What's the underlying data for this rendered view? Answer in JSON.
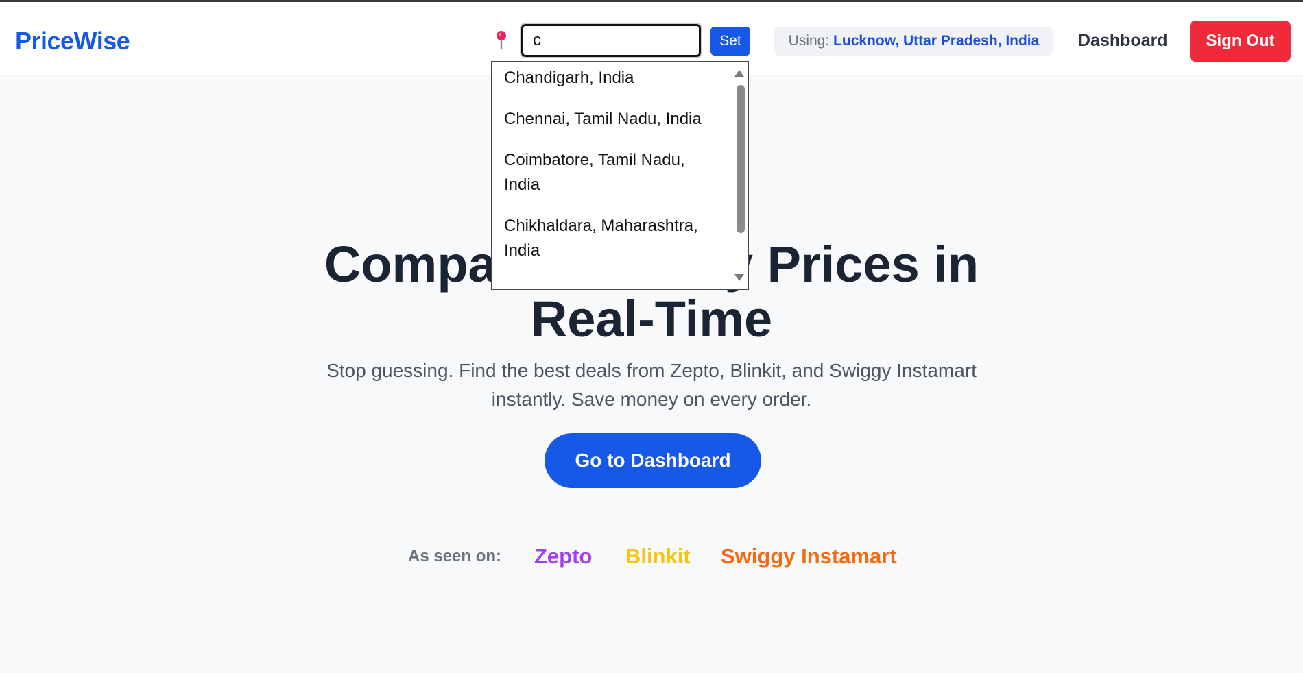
{
  "app": {
    "logo": "PriceWise"
  },
  "location": {
    "pin_icon": "map-pin-icon",
    "input_value": "c",
    "set_label": "Set",
    "using_prefix": "Using:",
    "using_city": "Lucknow, Uttar Pradesh, India",
    "suggestions": [
      {
        "line1": "Chandigarh, India",
        "line2": ""
      },
      {
        "line1": "Chennai, Tamil Nadu, India",
        "line2": ""
      },
      {
        "line1": "Coimbatore, Tamil Nadu,",
        "line2": "India"
      },
      {
        "line1": "Chikhaldara, Maharashtra,",
        "line2": "India"
      }
    ]
  },
  "nav": {
    "dashboard_label": "Dashboard",
    "signout_label": "Sign Out"
  },
  "hero": {
    "title_line1": "Compare Grocery Prices in",
    "title_line2": "Real-Time",
    "subtitle_line1": "Stop guessing. Find the best deals from Zepto, Blinkit, and Swiggy Instamart",
    "subtitle_line2": "instantly. Save money on every order.",
    "cta_label": "Go to Dashboard"
  },
  "seen_on": {
    "label": "As seen on:",
    "brands": [
      {
        "name": "Zepto",
        "color": "#a33ef0"
      },
      {
        "name": "Blinkit",
        "color": "#f5c414"
      },
      {
        "name": "Swiggy Instamart",
        "color": "#f26a12"
      }
    ]
  },
  "colors": {
    "accent": "#1659e8",
    "danger": "#ef2a3a",
    "heading": "#1b2433"
  }
}
